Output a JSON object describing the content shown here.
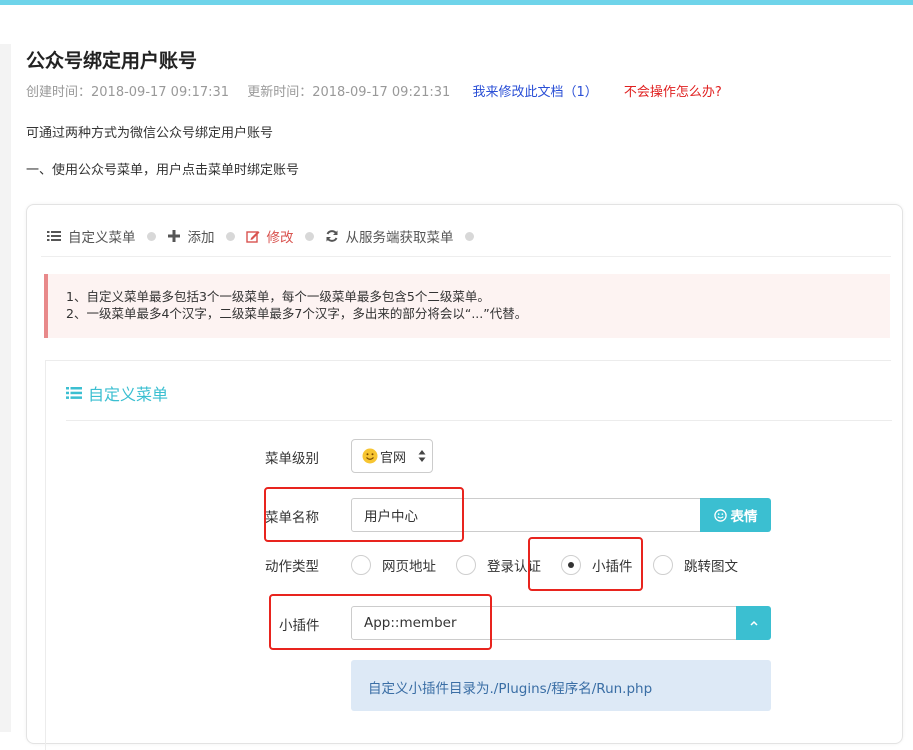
{
  "page": {
    "title": "公众号绑定用户账号",
    "meta": {
      "created": "创建时间：2018-09-17 09:17:31",
      "updated": "更新时间：2018-09-17 09:21:31",
      "edit_link": "我来修改此文档（1）",
      "help_link": "不会操作怎么办?"
    },
    "paragraphs": [
      "可通过两种方式为微信公众号绑定用户账号",
      "一、使用公众号菜单，用户点击菜单时绑定账号"
    ]
  },
  "toolbar": {
    "items": [
      {
        "label": "自定义菜单",
        "icon": "list-icon",
        "active": false
      },
      {
        "label": "添加",
        "icon": "plus-icon",
        "active": false
      },
      {
        "label": "修改",
        "icon": "edit-icon",
        "active": true
      },
      {
        "label": "从服务端获取菜单",
        "icon": "refresh-icon",
        "active": false
      }
    ]
  },
  "notice": {
    "lines": [
      "1、自定义菜单最多包括3个一级菜单，每个一级菜单最多包含5个二级菜单。",
      "2、一级菜单最多4个汉字，二级菜单最多7个汉字，多出来的部分将会以“...”代替。"
    ]
  },
  "form": {
    "title": "自定义菜单",
    "level_label": "菜单级别",
    "level_value": "官网",
    "name_label": "菜单名称",
    "name_value": "用户中心",
    "emoji_button": "表情",
    "action_label": "动作类型",
    "action_options": [
      "网页地址",
      "登录认证",
      "小插件",
      "跳转图文"
    ],
    "action_selected": "小插件",
    "plugin_label": "小插件",
    "plugin_value": "App::member",
    "plugin_hint": "自定义小插件目录为./Plugins/程序名/Run.php"
  },
  "colors": {
    "accent": "#3bbfd1",
    "top_bar": "#6fd4ea",
    "link": "#2a4fd6",
    "danger": "#e02020",
    "highlight_box": "#e8241e"
  }
}
